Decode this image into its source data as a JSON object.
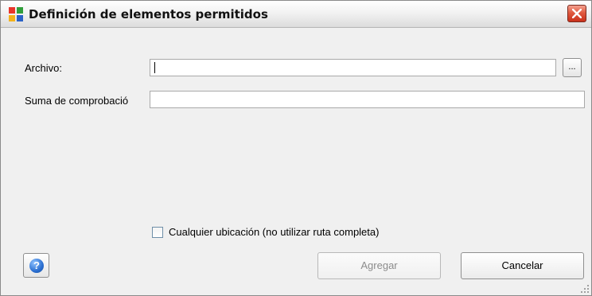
{
  "window": {
    "title": "Definición de elementos permitidos"
  },
  "form": {
    "archivo_label": "Archivo:",
    "archivo_value": "",
    "browse_label": "...",
    "checksum_label": "Suma de comprobació",
    "checksum_value": ""
  },
  "options": {
    "any_location_label": "Cualquier ubicación (no utilizar ruta completa)",
    "any_location_checked": false
  },
  "buttons": {
    "help_glyph": "?",
    "agregar_label": "Agregar",
    "agregar_enabled": false,
    "cancelar_label": "Cancelar"
  },
  "icons": {
    "app": "avg-app-icon",
    "close": "close-icon",
    "help": "help-icon",
    "grip": "resize-grip-icon"
  }
}
